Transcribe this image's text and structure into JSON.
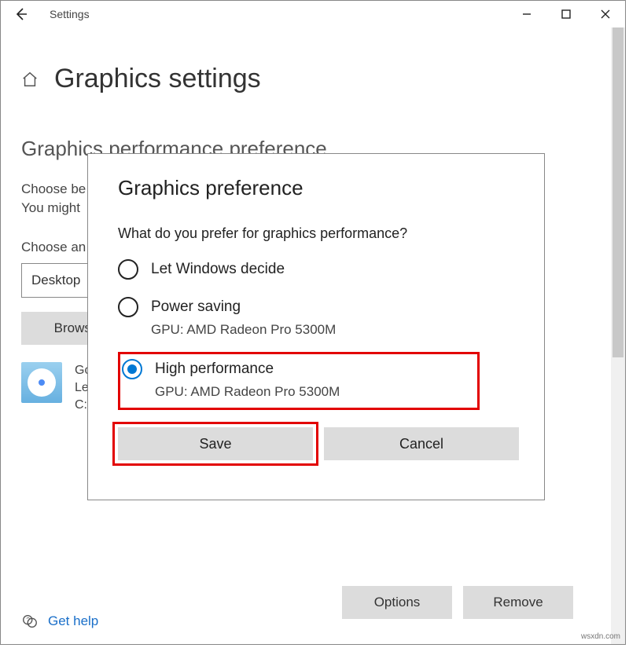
{
  "titlebar": {
    "title": "Settings"
  },
  "page": {
    "title": "Graphics settings",
    "section": "Graphics performance preference",
    "desc1": "Choose be",
    "desc2": "You might",
    "choose_label": "Choose an",
    "select_value": "Desktop",
    "browse": "Browse"
  },
  "app": {
    "name": "Go",
    "line2": "Le",
    "line3": "C:"
  },
  "buttons": {
    "options": "Options",
    "remove": "Remove"
  },
  "help": {
    "text": "Get help"
  },
  "dialog": {
    "title": "Graphics preference",
    "question": "What do you prefer for graphics performance?",
    "opt1": "Let Windows decide",
    "opt2": "Power saving",
    "opt2_gpu": "GPU: AMD Radeon Pro 5300M",
    "opt3": "High performance",
    "opt3_gpu": "GPU: AMD Radeon Pro 5300M",
    "save": "Save",
    "cancel": "Cancel"
  },
  "watermark": "wsxdn.com"
}
